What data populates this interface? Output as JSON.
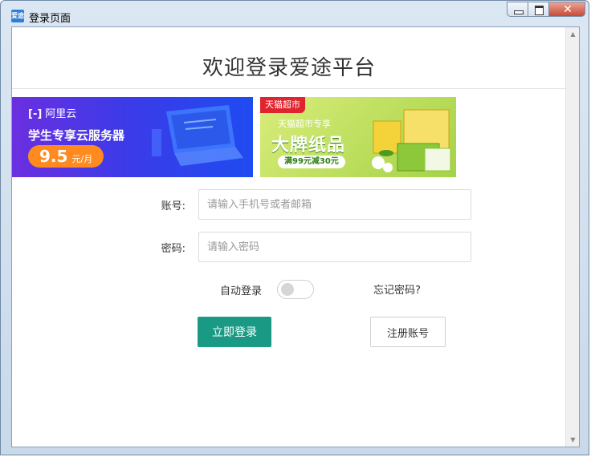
{
  "window": {
    "title": "登录页面",
    "app_icon_text": "爱途",
    "controls": {
      "minimize": "minimize-icon",
      "maximize": "maximize-icon",
      "close": "close-icon"
    }
  },
  "page": {
    "title": "欢迎登录爱途平台"
  },
  "ads": {
    "aliyun": {
      "logo": "阿里云",
      "promo": "学生专享云服务器",
      "price": "9.5",
      "unit": "元/月"
    },
    "tmall": {
      "tag": "天猫超市",
      "subtitle": "天猫超市专享",
      "headline": "大牌纸品",
      "deal": "满99元减30元"
    }
  },
  "form": {
    "account_label": "账号:",
    "account_placeholder": "请输入手机号或者邮箱",
    "password_label": "密码:",
    "password_placeholder": "请输入密码",
    "remember_label": "自动登录",
    "remember_on": false,
    "forgot_label": "忘记密码?",
    "login_label": "立即登录",
    "register_label": "注册账号"
  },
  "colors": {
    "primary": "#1a9a84",
    "tmall_red": "#e0242e",
    "aliyun_orange": "#ff8a1f"
  }
}
